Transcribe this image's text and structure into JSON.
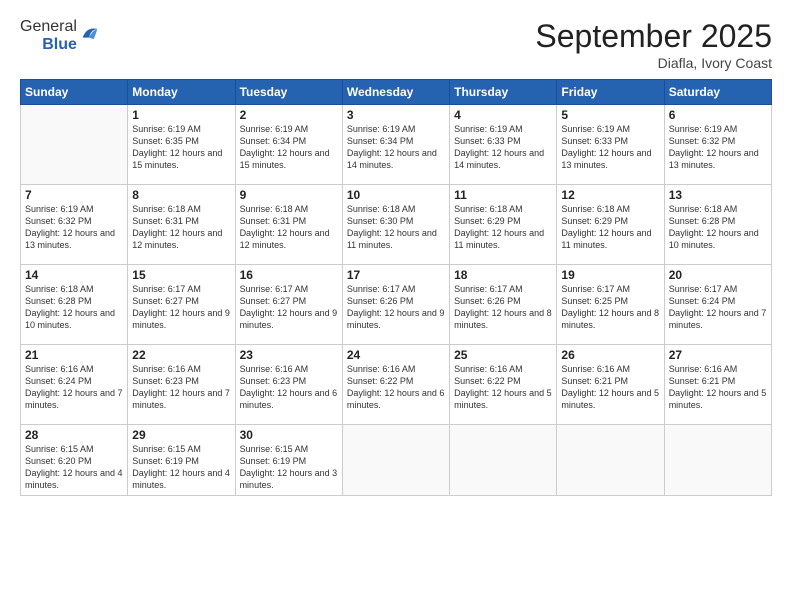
{
  "logo": {
    "general": "General",
    "blue": "Blue"
  },
  "header": {
    "month": "September 2025",
    "location": "Diafla, Ivory Coast"
  },
  "weekdays": [
    "Sunday",
    "Monday",
    "Tuesday",
    "Wednesday",
    "Thursday",
    "Friday",
    "Saturday"
  ],
  "weeks": [
    [
      {
        "day": "",
        "sunrise": "",
        "sunset": "",
        "daylight": ""
      },
      {
        "day": "1",
        "sunrise": "Sunrise: 6:19 AM",
        "sunset": "Sunset: 6:35 PM",
        "daylight": "Daylight: 12 hours and 15 minutes."
      },
      {
        "day": "2",
        "sunrise": "Sunrise: 6:19 AM",
        "sunset": "Sunset: 6:34 PM",
        "daylight": "Daylight: 12 hours and 15 minutes."
      },
      {
        "day": "3",
        "sunrise": "Sunrise: 6:19 AM",
        "sunset": "Sunset: 6:34 PM",
        "daylight": "Daylight: 12 hours and 14 minutes."
      },
      {
        "day": "4",
        "sunrise": "Sunrise: 6:19 AM",
        "sunset": "Sunset: 6:33 PM",
        "daylight": "Daylight: 12 hours and 14 minutes."
      },
      {
        "day": "5",
        "sunrise": "Sunrise: 6:19 AM",
        "sunset": "Sunset: 6:33 PM",
        "daylight": "Daylight: 12 hours and 13 minutes."
      },
      {
        "day": "6",
        "sunrise": "Sunrise: 6:19 AM",
        "sunset": "Sunset: 6:32 PM",
        "daylight": "Daylight: 12 hours and 13 minutes."
      }
    ],
    [
      {
        "day": "7",
        "sunrise": "Sunrise: 6:19 AM",
        "sunset": "Sunset: 6:32 PM",
        "daylight": "Daylight: 12 hours and 13 minutes."
      },
      {
        "day": "8",
        "sunrise": "Sunrise: 6:18 AM",
        "sunset": "Sunset: 6:31 PM",
        "daylight": "Daylight: 12 hours and 12 minutes."
      },
      {
        "day": "9",
        "sunrise": "Sunrise: 6:18 AM",
        "sunset": "Sunset: 6:31 PM",
        "daylight": "Daylight: 12 hours and 12 minutes."
      },
      {
        "day": "10",
        "sunrise": "Sunrise: 6:18 AM",
        "sunset": "Sunset: 6:30 PM",
        "daylight": "Daylight: 12 hours and 11 minutes."
      },
      {
        "day": "11",
        "sunrise": "Sunrise: 6:18 AM",
        "sunset": "Sunset: 6:29 PM",
        "daylight": "Daylight: 12 hours and 11 minutes."
      },
      {
        "day": "12",
        "sunrise": "Sunrise: 6:18 AM",
        "sunset": "Sunset: 6:29 PM",
        "daylight": "Daylight: 12 hours and 11 minutes."
      },
      {
        "day": "13",
        "sunrise": "Sunrise: 6:18 AM",
        "sunset": "Sunset: 6:28 PM",
        "daylight": "Daylight: 12 hours and 10 minutes."
      }
    ],
    [
      {
        "day": "14",
        "sunrise": "Sunrise: 6:18 AM",
        "sunset": "Sunset: 6:28 PM",
        "daylight": "Daylight: 12 hours and 10 minutes."
      },
      {
        "day": "15",
        "sunrise": "Sunrise: 6:17 AM",
        "sunset": "Sunset: 6:27 PM",
        "daylight": "Daylight: 12 hours and 9 minutes."
      },
      {
        "day": "16",
        "sunrise": "Sunrise: 6:17 AM",
        "sunset": "Sunset: 6:27 PM",
        "daylight": "Daylight: 12 hours and 9 minutes."
      },
      {
        "day": "17",
        "sunrise": "Sunrise: 6:17 AM",
        "sunset": "Sunset: 6:26 PM",
        "daylight": "Daylight: 12 hours and 9 minutes."
      },
      {
        "day": "18",
        "sunrise": "Sunrise: 6:17 AM",
        "sunset": "Sunset: 6:26 PM",
        "daylight": "Daylight: 12 hours and 8 minutes."
      },
      {
        "day": "19",
        "sunrise": "Sunrise: 6:17 AM",
        "sunset": "Sunset: 6:25 PM",
        "daylight": "Daylight: 12 hours and 8 minutes."
      },
      {
        "day": "20",
        "sunrise": "Sunrise: 6:17 AM",
        "sunset": "Sunset: 6:24 PM",
        "daylight": "Daylight: 12 hours and 7 minutes."
      }
    ],
    [
      {
        "day": "21",
        "sunrise": "Sunrise: 6:16 AM",
        "sunset": "Sunset: 6:24 PM",
        "daylight": "Daylight: 12 hours and 7 minutes."
      },
      {
        "day": "22",
        "sunrise": "Sunrise: 6:16 AM",
        "sunset": "Sunset: 6:23 PM",
        "daylight": "Daylight: 12 hours and 7 minutes."
      },
      {
        "day": "23",
        "sunrise": "Sunrise: 6:16 AM",
        "sunset": "Sunset: 6:23 PM",
        "daylight": "Daylight: 12 hours and 6 minutes."
      },
      {
        "day": "24",
        "sunrise": "Sunrise: 6:16 AM",
        "sunset": "Sunset: 6:22 PM",
        "daylight": "Daylight: 12 hours and 6 minutes."
      },
      {
        "day": "25",
        "sunrise": "Sunrise: 6:16 AM",
        "sunset": "Sunset: 6:22 PM",
        "daylight": "Daylight: 12 hours and 5 minutes."
      },
      {
        "day": "26",
        "sunrise": "Sunrise: 6:16 AM",
        "sunset": "Sunset: 6:21 PM",
        "daylight": "Daylight: 12 hours and 5 minutes."
      },
      {
        "day": "27",
        "sunrise": "Sunrise: 6:16 AM",
        "sunset": "Sunset: 6:21 PM",
        "daylight": "Daylight: 12 hours and 5 minutes."
      }
    ],
    [
      {
        "day": "28",
        "sunrise": "Sunrise: 6:15 AM",
        "sunset": "Sunset: 6:20 PM",
        "daylight": "Daylight: 12 hours and 4 minutes."
      },
      {
        "day": "29",
        "sunrise": "Sunrise: 6:15 AM",
        "sunset": "Sunset: 6:19 PM",
        "daylight": "Daylight: 12 hours and 4 minutes."
      },
      {
        "day": "30",
        "sunrise": "Sunrise: 6:15 AM",
        "sunset": "Sunset: 6:19 PM",
        "daylight": "Daylight: 12 hours and 3 minutes."
      },
      {
        "day": "",
        "sunrise": "",
        "sunset": "",
        "daylight": ""
      },
      {
        "day": "",
        "sunrise": "",
        "sunset": "",
        "daylight": ""
      },
      {
        "day": "",
        "sunrise": "",
        "sunset": "",
        "daylight": ""
      },
      {
        "day": "",
        "sunrise": "",
        "sunset": "",
        "daylight": ""
      }
    ]
  ]
}
